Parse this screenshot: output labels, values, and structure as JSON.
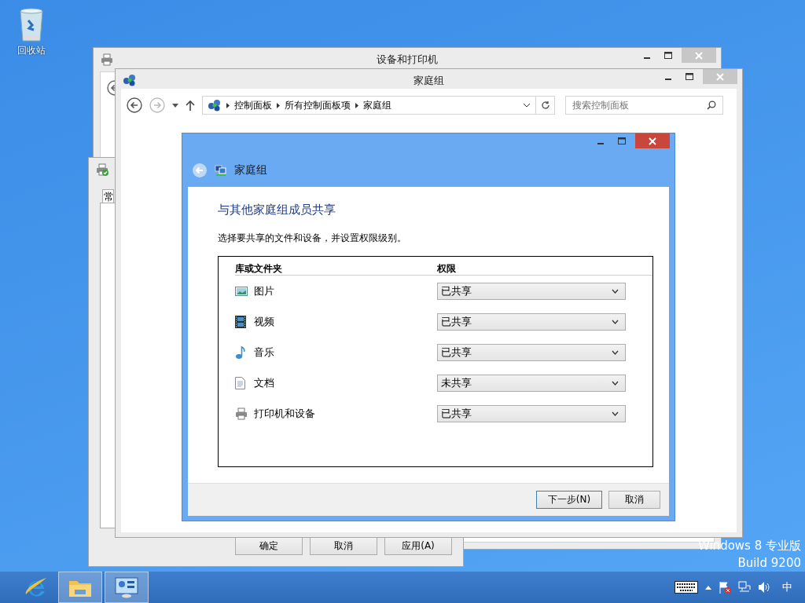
{
  "desktop_icons": [
    {
      "label": "回收站"
    }
  ],
  "devices_window": {
    "title": "设备和打印机"
  },
  "properties_dialog": {
    "tab": "常",
    "buttons": [
      "确定",
      "取消",
      "应用(A)"
    ]
  },
  "homegroup_window": {
    "title": "家庭组",
    "breadcrumb": [
      "控制面板",
      "所有控制面板项",
      "家庭组"
    ],
    "search": {
      "placeholder": "搜索控制面板"
    }
  },
  "wizard": {
    "header": "家庭组",
    "heading": "与其他家庭组成员共享",
    "instruction": "选择要共享的文件和设备，并设置权限级别。",
    "columns": [
      "库或文件夹",
      "权限"
    ],
    "rows": [
      {
        "kind": "pictures",
        "name": "图片",
        "permission": "已共享"
      },
      {
        "kind": "videos",
        "name": "视频",
        "permission": "已共享"
      },
      {
        "kind": "music",
        "name": "音乐",
        "permission": "已共享"
      },
      {
        "kind": "documents",
        "name": "文档",
        "permission": "未共享"
      },
      {
        "kind": "printers",
        "name": "打印机和设备",
        "permission": "已共享"
      }
    ],
    "buttons": [
      "下一步(N)",
      "取消"
    ]
  },
  "os_edition": [
    "Windows 8 专业版",
    "Build 9200"
  ],
  "taskbar": {
    "input_language": "中"
  }
}
